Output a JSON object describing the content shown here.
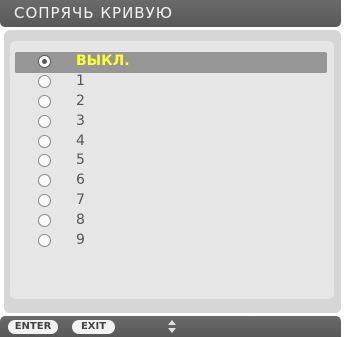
{
  "title": "СОПРЯЧЬ КРИВУЮ",
  "options": [
    {
      "label": "ВЫКЛ.",
      "selected": true
    },
    {
      "label": "1",
      "selected": false
    },
    {
      "label": "2",
      "selected": false
    },
    {
      "label": "3",
      "selected": false
    },
    {
      "label": "4",
      "selected": false
    },
    {
      "label": "5",
      "selected": false
    },
    {
      "label": "6",
      "selected": false
    },
    {
      "label": "7",
      "selected": false
    },
    {
      "label": "8",
      "selected": false
    },
    {
      "label": "9",
      "selected": false
    }
  ],
  "footer": {
    "enter_label": "ENTER",
    "exit_label": "EXIT",
    "nav_icon": "up-down-arrows-icon"
  },
  "colors": {
    "title_bar": "#606060",
    "selected_highlight": "#969696",
    "selected_text": "#ffff33",
    "item_text": "#555555"
  }
}
